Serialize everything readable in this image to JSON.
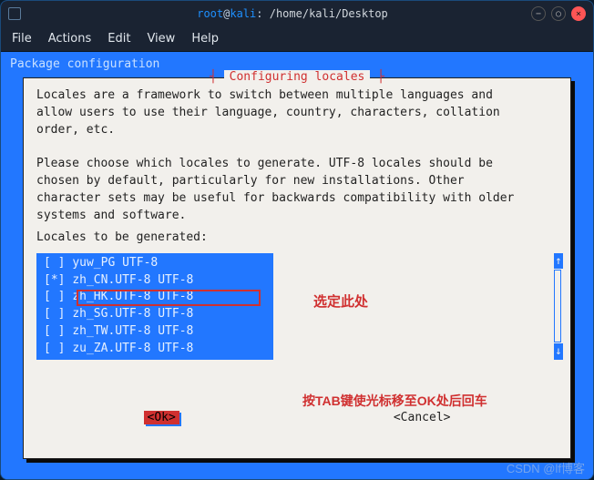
{
  "window": {
    "title_user": "root",
    "title_at": "@",
    "title_host": "kali",
    "title_sep": ": ",
    "title_path": "/home/kali/Desktop"
  },
  "menubar": {
    "file": "File",
    "actions": "Actions",
    "edit": "Edit",
    "view": "View",
    "help": "Help"
  },
  "terminal": {
    "package_configuration": "Package configuration"
  },
  "dialog": {
    "title": "Configuring locales",
    "desc_line1": "Locales are a framework to switch between multiple languages and",
    "desc_line2": "allow users to use their language, country, characters, collation",
    "desc_line3": "order, etc.",
    "desc_line4": "Please choose which locales to generate. UTF-8 locales should be",
    "desc_line5": "chosen by default, particularly for new installations. Other",
    "desc_line6": "character sets may be useful for backwards compatibility with older",
    "desc_line7": "systems and software.",
    "prompt": "Locales to be generated:",
    "items": [
      {
        "mark": " ",
        "label": "yuw_PG UTF-8"
      },
      {
        "mark": "*",
        "label": "zh_CN.UTF-8 UTF-8"
      },
      {
        "mark": " ",
        "label": "zh_HK.UTF-8 UTF-8"
      },
      {
        "mark": " ",
        "label": "zh_SG.UTF-8 UTF-8"
      },
      {
        "mark": " ",
        "label": "zh_TW.UTF-8 UTF-8"
      },
      {
        "mark": " ",
        "label": "zu_ZA.UTF-8 UTF-8"
      }
    ],
    "ok": "<Ok>",
    "cancel": "<Cancel>"
  },
  "annotations": {
    "select_here": "选定此处",
    "tab_hint": "按TAB键使光标移至OK处后回车"
  },
  "watermark": "CSDN @lf博客"
}
